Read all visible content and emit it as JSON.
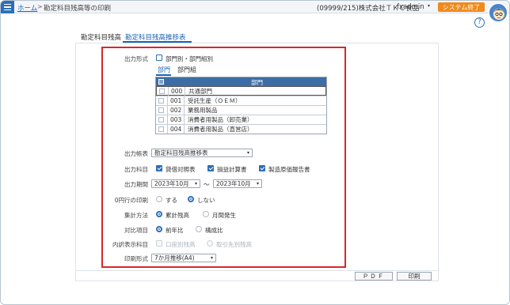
{
  "header": {
    "home_label": "ホーム",
    "separator": ">",
    "page_title": "勘定科目残高等の印刷",
    "company": "(09999/215)株式会社ＴＫＣ食品",
    "user": "fxadmin",
    "user_caret": "▾",
    "exit_label": "システム終了",
    "help_glyph": "?"
  },
  "tabs": [
    {
      "label": "勘定科目残高",
      "active": false
    },
    {
      "label": "勘定科目残高推移表",
      "active": true
    }
  ],
  "form": {
    "output_format": {
      "label": "出力形式",
      "checkbox_label": "部門別・部門組別",
      "checked": false,
      "subtabs": [
        {
          "label": "部門",
          "active": true
        },
        {
          "label": "部門組",
          "active": false
        }
      ],
      "table_header": "部門",
      "departments": [
        {
          "code": "000",
          "name": "共通部門"
        },
        {
          "code": "001",
          "name": "受託生産（ＯＥＭ）"
        },
        {
          "code": "002",
          "name": "業務用製品"
        },
        {
          "code": "003",
          "name": "消費者用製品（卸売業）"
        },
        {
          "code": "004",
          "name": "消費者用製品（直営店）"
        }
      ]
    },
    "report": {
      "label": "出力帳表",
      "value": "勘定科目残高推移表"
    },
    "subjects": {
      "label": "出力科目",
      "options": [
        {
          "label": "貸借対照表",
          "checked": true
        },
        {
          "label": "損益計算書",
          "checked": true
        },
        {
          "label": "製造原価報告書",
          "checked": true
        }
      ]
    },
    "period": {
      "label": "出力期間",
      "from": "2023年10月",
      "separator": "～",
      "to": "2023年10月"
    },
    "zero_rows": {
      "label": "0円行の印刷",
      "options": [
        {
          "label": "する",
          "selected": false
        },
        {
          "label": "しない",
          "selected": true
        }
      ]
    },
    "aggregation": {
      "label": "集計方法",
      "options": [
        {
          "label": "累計残高",
          "selected": true
        },
        {
          "label": "月間発生",
          "selected": false
        }
      ]
    },
    "comparison": {
      "label": "対比項目",
      "options": [
        {
          "label": "前年比",
          "selected": true
        },
        {
          "label": "構成比",
          "selected": false
        }
      ]
    },
    "breakdown": {
      "label": "内訳表示科目",
      "options": [
        {
          "label": "口座別残高",
          "enabled": false
        },
        {
          "label": "取引先別残高",
          "enabled": false
        }
      ]
    },
    "print_format": {
      "label": "印刷形式",
      "value": "7か月推移(A4)"
    }
  },
  "footer": {
    "pdf_label": "ＰＤＦ",
    "print_label": "印刷"
  },
  "colors": {
    "accent": "#2c6fb8",
    "exit_button": "#f08a1c",
    "highlight_border": "#d9262c",
    "table_header": "#3d6da6"
  }
}
